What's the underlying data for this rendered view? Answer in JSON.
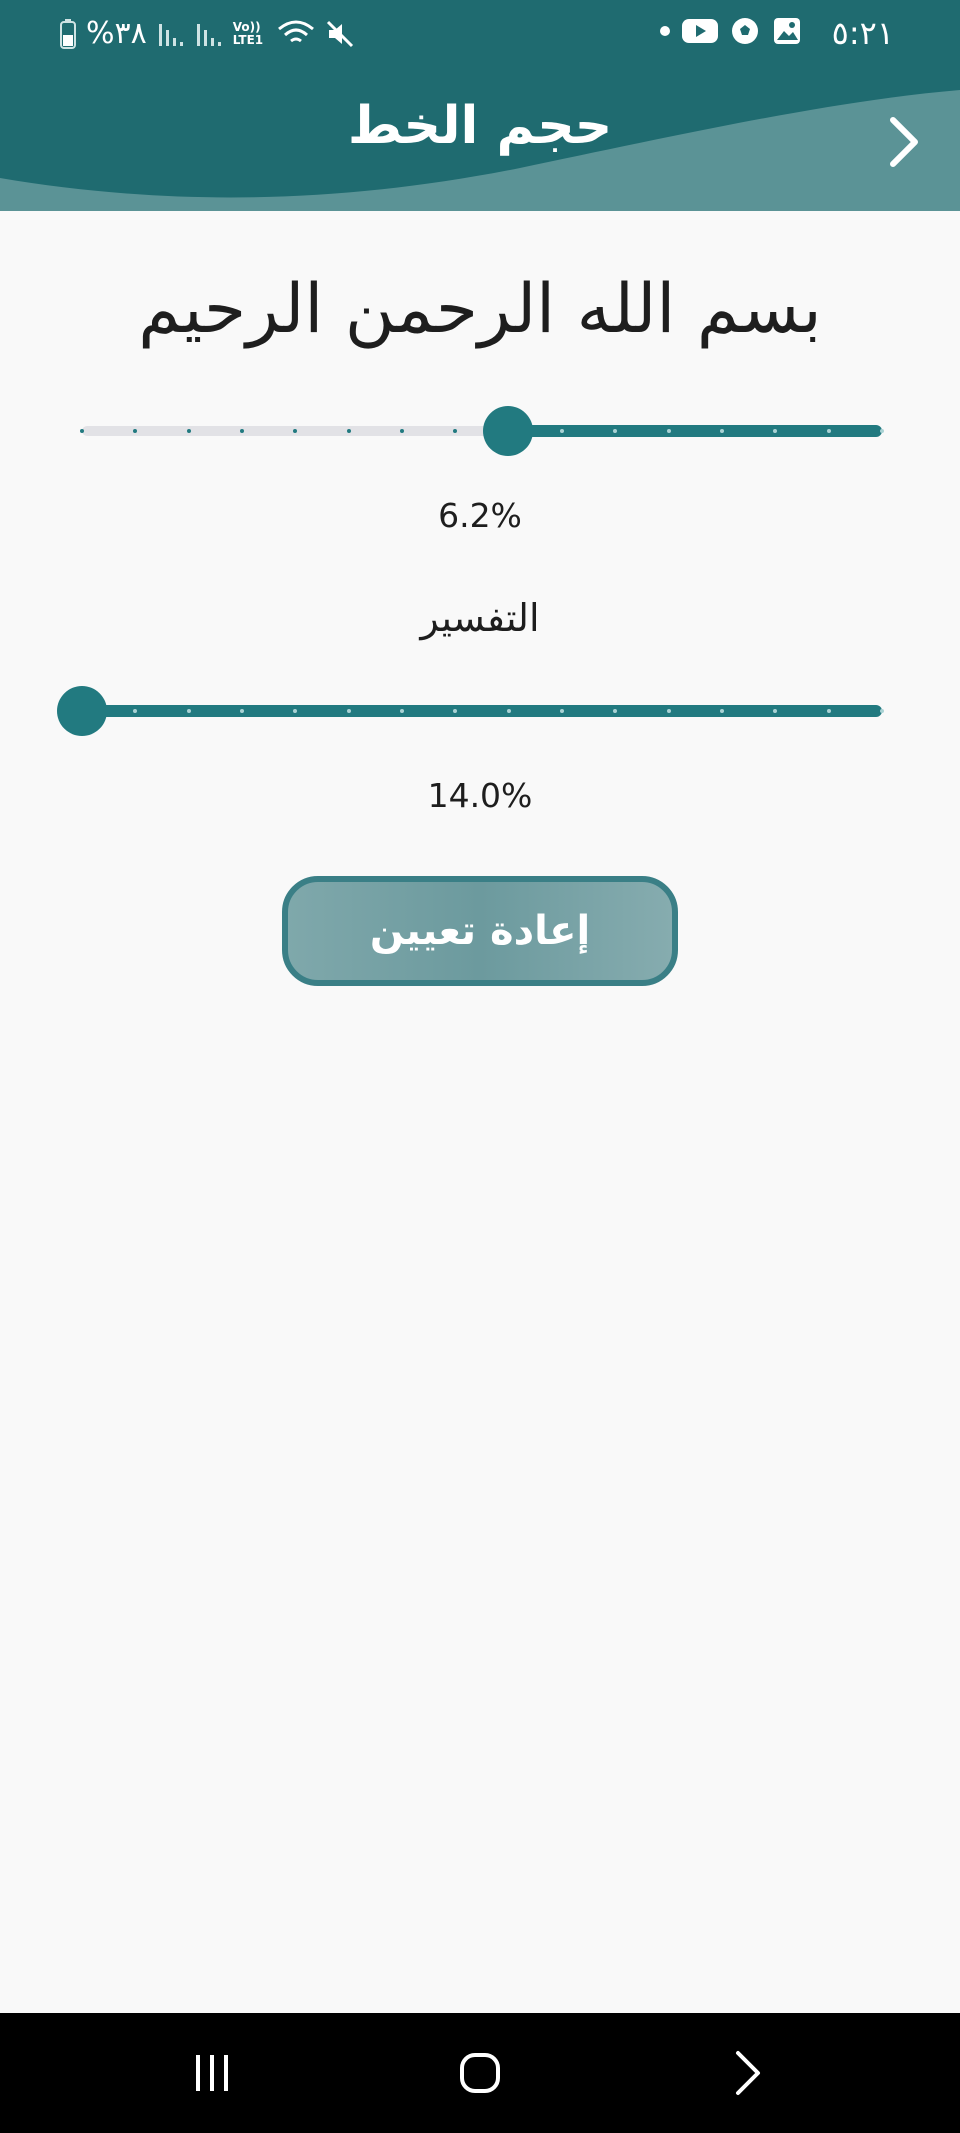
{
  "status_bar": {
    "time": "٥:٢١",
    "battery_percent": "%٣٨",
    "network_label": "Vo)) LTE1",
    "icons": [
      "battery-icon",
      "signal-icon",
      "signal-icon",
      "volte-icon",
      "wifi-icon",
      "mute-icon",
      "dot-icon",
      "youtube-icon",
      "football-icon",
      "gallery-icon"
    ]
  },
  "header": {
    "title": "حجم الخط",
    "back_icon": "chevron-right-icon"
  },
  "preview": {
    "text": "بسم الله الرحمن الرحيم"
  },
  "quran_slider": {
    "value_label": "6.2%",
    "level": 0.467,
    "steps": 16
  },
  "tafsir": {
    "label": "التفسير",
    "value_label": "14.0%",
    "level": 1.0,
    "steps": 16
  },
  "reset_button": {
    "label": "إعادة تعيين"
  },
  "navbar": {
    "items": [
      "recents-icon",
      "home-icon",
      "back-icon"
    ]
  },
  "colors": {
    "primary": "#227a80",
    "header": "#1f6b70",
    "header_wave": "#5b9396",
    "background": "#f9f9f9"
  }
}
